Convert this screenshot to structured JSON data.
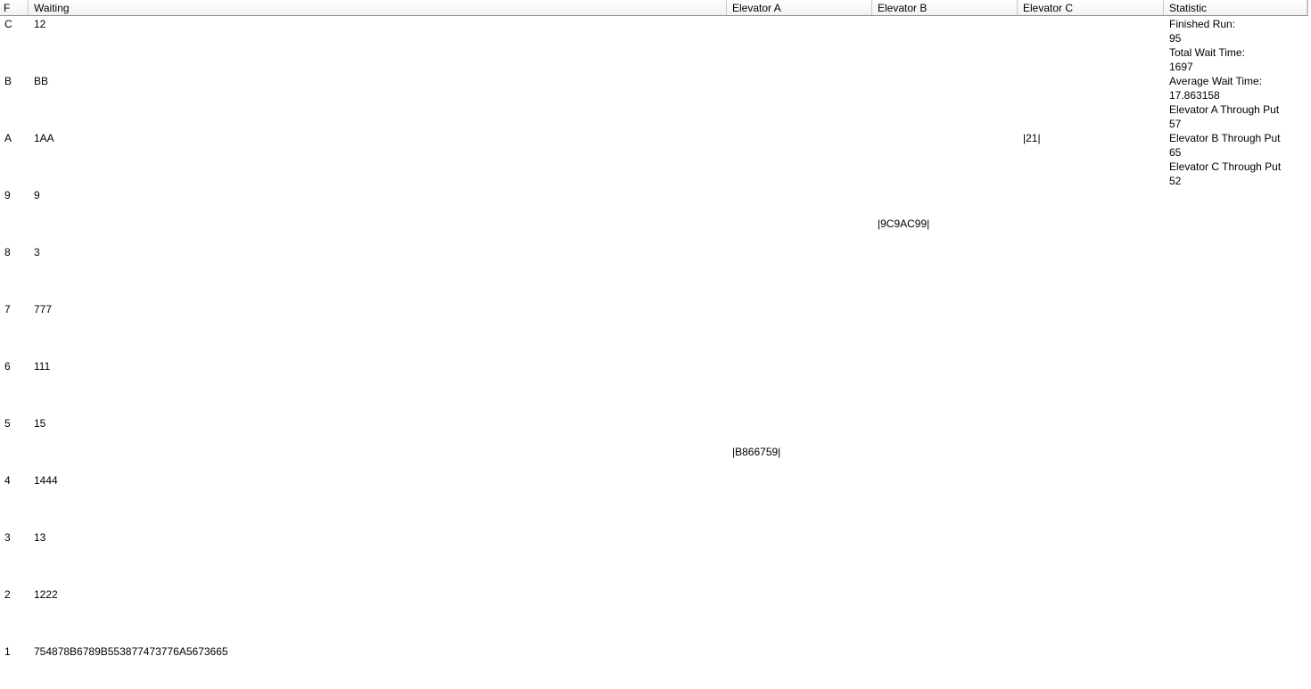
{
  "columns": [
    "F",
    "Waiting",
    "Elevator A",
    "Elevator B",
    "Elevator C",
    "Statistic"
  ],
  "rows": [
    {
      "floor": "C",
      "waiting": "12",
      "elevator_a": "",
      "elevator_b": "",
      "elevator_c": ""
    },
    {
      "floor": "B",
      "waiting": "BB",
      "elevator_a": "",
      "elevator_b": "",
      "elevator_c": ""
    },
    {
      "floor": "A",
      "waiting": "1AA",
      "elevator_a": "",
      "elevator_b": "",
      "elevator_c": "|21|"
    },
    {
      "floor": "9",
      "waiting": "9",
      "elevator_a": "",
      "elevator_b": "",
      "elevator_c": ""
    },
    {
      "floor": "",
      "waiting": "",
      "elevator_a": "",
      "elevator_b": "|9C9AC99|",
      "elevator_c": ""
    },
    {
      "floor": "8",
      "waiting": "3",
      "elevator_a": "",
      "elevator_b": "",
      "elevator_c": ""
    },
    {
      "floor": "7",
      "waiting": "777",
      "elevator_a": "",
      "elevator_b": "",
      "elevator_c": ""
    },
    {
      "floor": "6",
      "waiting": "111",
      "elevator_a": "",
      "elevator_b": "",
      "elevator_c": ""
    },
    {
      "floor": "5",
      "waiting": "15",
      "elevator_a": "",
      "elevator_b": "",
      "elevator_c": ""
    },
    {
      "floor": "",
      "waiting": "",
      "elevator_a": "|B866759|",
      "elevator_b": "",
      "elevator_c": ""
    },
    {
      "floor": "4",
      "waiting": "1444",
      "elevator_a": "",
      "elevator_b": "",
      "elevator_c": ""
    },
    {
      "floor": "3",
      "waiting": "13",
      "elevator_a": "",
      "elevator_b": "",
      "elevator_c": ""
    },
    {
      "floor": "2",
      "waiting": "1222",
      "elevator_a": "",
      "elevator_b": "",
      "elevator_c": ""
    },
    {
      "floor": "1",
      "waiting": "754878B6789B553877473776A5673665",
      "elevator_a": "",
      "elevator_b": "",
      "elevator_c": ""
    }
  ],
  "statistics": {
    "finished_run_label": "Finished Run:",
    "finished_run_value": "95",
    "total_wait_label": "Total Wait Time:",
    "total_wait_value": "1697",
    "avg_wait_label": "Average Wait Time:",
    "avg_wait_value": "17.863158",
    "a_throughput_label": "Elevator A Through Put",
    "a_throughput_value": "57",
    "b_throughput_label": "Elevator B Through Put",
    "b_throughput_value": "65",
    "c_throughput_label": "Elevator C Through Put",
    "c_throughput_value": "52"
  }
}
